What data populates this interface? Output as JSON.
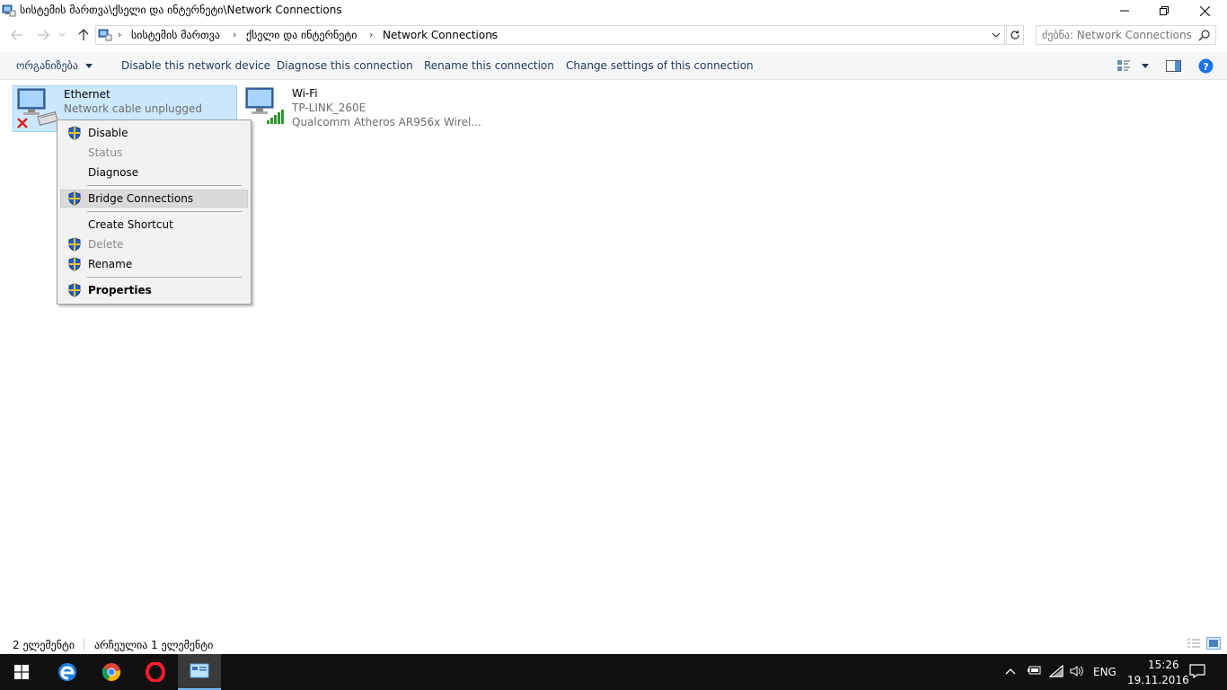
{
  "window": {
    "title": "სისტემის მართვა\\ქსელი და ინტერნეტი\\Network Connections",
    "minimize_icon": "minimize-icon",
    "restore_icon": "restore-icon",
    "close_icon": "close-icon"
  },
  "address": {
    "crumbs": [
      "სისტემის მართვა",
      "ქსელი და ინტერნეტი",
      "Network Connections"
    ],
    "search_placeholder": "ძებნა: Network Connections"
  },
  "commands": {
    "organize": "ორგანიზება",
    "disable_device": "Disable this network device",
    "diagnose": "Diagnose this connection",
    "rename": "Rename this connection",
    "change_settings": "Change settings of this connection"
  },
  "connections": [
    {
      "name": "Ethernet",
      "status": "Network cable unplugged",
      "selected": true
    },
    {
      "name": "Wi-Fi",
      "network": "TP-LINK_260E",
      "adapter": "Qualcomm Atheros AR956x Wirel..."
    }
  ],
  "context_menu": {
    "items": [
      {
        "label": "Disable",
        "shield": true,
        "disabled": false
      },
      {
        "label": "Status",
        "shield": false,
        "disabled": true
      },
      {
        "label": "Diagnose",
        "shield": false,
        "disabled": false
      },
      {
        "label": "Bridge Connections",
        "shield": true,
        "disabled": false,
        "hover": true
      },
      {
        "label": "Create Shortcut",
        "shield": false,
        "disabled": false
      },
      {
        "label": "Delete",
        "shield": true,
        "disabled": true
      },
      {
        "label": "Rename",
        "shield": true,
        "disabled": false
      },
      {
        "label": "Properties",
        "shield": true,
        "disabled": false,
        "bold": true
      }
    ]
  },
  "status_bar": {
    "items_count": "2 ელემენტი",
    "selected_count": "არჩეულია 1 ელემენტი"
  },
  "taskbar": {
    "language": "ENG",
    "time": "15:26",
    "date": "19.11.2016"
  },
  "colors": {
    "selection_bg": "#cce8ff",
    "selection_border": "#99d1ff",
    "command_text": "#1e395b",
    "taskbar_bg": "#101010",
    "help_blue": "#1a73e8"
  }
}
